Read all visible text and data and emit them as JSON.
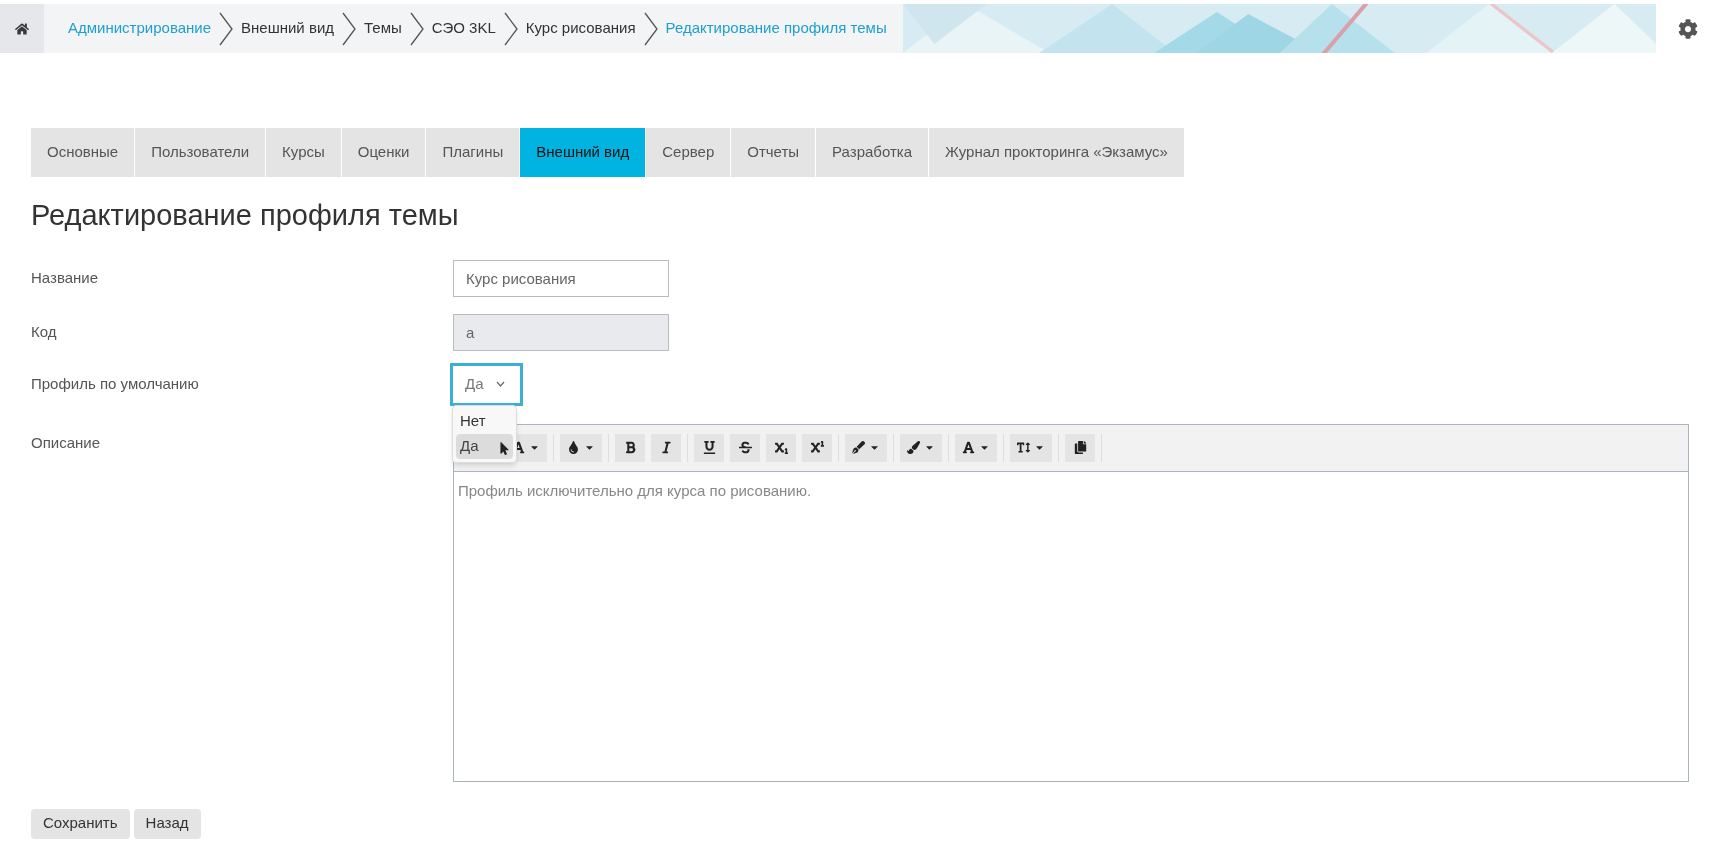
{
  "breadcrumb": [
    {
      "label": "Администрирование",
      "link": true
    },
    {
      "label": "Внешний вид",
      "link": false
    },
    {
      "label": "Темы",
      "link": false
    },
    {
      "label": "СЭО 3KL",
      "link": false
    },
    {
      "label": "Курс рисования",
      "link": false
    },
    {
      "label": "Редактирование профиля темы",
      "link": true
    }
  ],
  "tabs": [
    {
      "label": "Основные",
      "selected": false
    },
    {
      "label": "Пользователи",
      "selected": false
    },
    {
      "label": "Курсы",
      "selected": false
    },
    {
      "label": "Оценки",
      "selected": false
    },
    {
      "label": "Плагины",
      "selected": false
    },
    {
      "label": "Внешний вид",
      "selected": true
    },
    {
      "label": "Сервер",
      "selected": false
    },
    {
      "label": "Отчеты",
      "selected": false
    },
    {
      "label": "Разработка",
      "selected": false
    },
    {
      "label": "Журнал прокторинга «Экзамус»",
      "selected": false
    }
  ],
  "page_title": "Редактирование профиля темы",
  "form": {
    "name": {
      "label": "Название",
      "value": "Курс рисования"
    },
    "code": {
      "label": "Код",
      "value": "a",
      "disabled": true
    },
    "default_profile": {
      "label": "Профиль по умолчанию",
      "value": "Да",
      "expanded": true,
      "options": [
        {
          "label": "Нет",
          "selected": false
        },
        {
          "label": "Да",
          "selected": true
        }
      ]
    },
    "description": {
      "label": "Описание",
      "value": "Профиль исключительно для курса по рисованию."
    }
  },
  "buttons": [
    "Сохранить",
    "Назад"
  ]
}
